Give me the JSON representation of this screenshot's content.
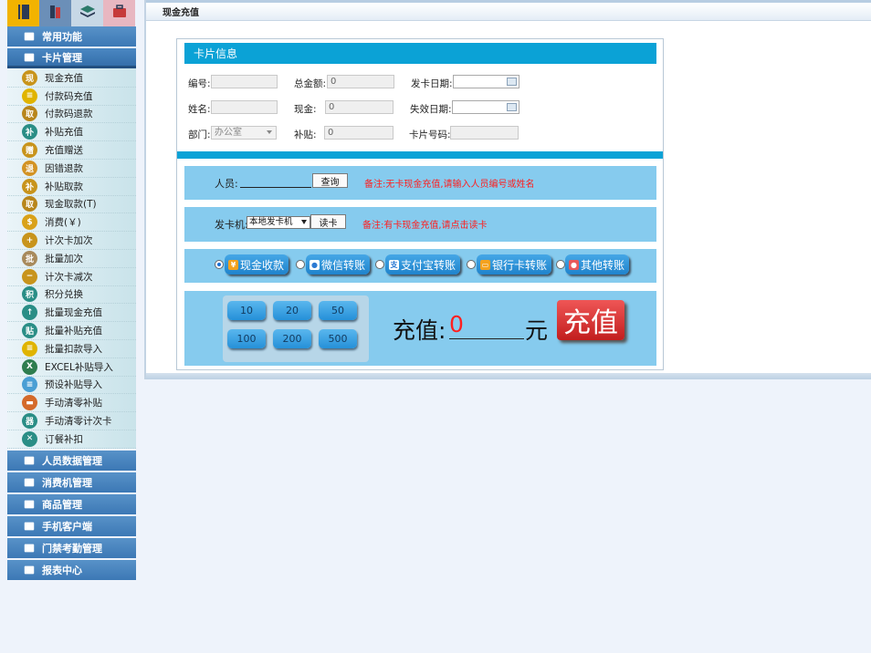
{
  "sidebar": {
    "top_tabs": [
      {
        "icon": "notebook-icon",
        "color": "#f2b300"
      },
      {
        "icon": "books-icon",
        "color": "#6b8fb8"
      },
      {
        "icon": "stack-icon",
        "color": "#c7d8e6"
      },
      {
        "icon": "briefcase-icon",
        "color": "#e8b7c1"
      }
    ],
    "sections_top": [
      {
        "label": "常用功能",
        "icon": "layers-icon"
      },
      {
        "label": "卡片管理",
        "icon": "card-icon"
      }
    ],
    "sub_items": [
      {
        "label": "现金充值",
        "glyph": "现",
        "color": "#c8941c"
      },
      {
        "label": "付款码充值",
        "glyph": "≡",
        "color": "#e0b400"
      },
      {
        "label": "付款码退款",
        "glyph": "取",
        "color": "#b8861c"
      },
      {
        "label": "补贴充值",
        "glyph": "补",
        "color": "#2a8e86"
      },
      {
        "label": "充值赠送",
        "glyph": "赠",
        "color": "#c8941c"
      },
      {
        "label": "因错退款",
        "glyph": "退",
        "color": "#d39324"
      },
      {
        "label": "补贴取款",
        "glyph": "补",
        "color": "#c8941c"
      },
      {
        "label": "现金取款(T)",
        "glyph": "取",
        "color": "#b8861c"
      },
      {
        "label": "消费(￥)",
        "glyph": "$",
        "color": "#d9a21a"
      },
      {
        "label": "计次卡加次",
        "glyph": "+",
        "color": "#c8941c"
      },
      {
        "label": "批量加次",
        "glyph": "批",
        "color": "#a88a5c"
      },
      {
        "label": "计次卡减次",
        "glyph": "−",
        "color": "#c8941c"
      },
      {
        "label": "积分兑换",
        "glyph": "积",
        "color": "#2a8e86"
      },
      {
        "label": "批量现金充值",
        "glyph": "↑",
        "color": "#2a8e86"
      },
      {
        "label": "批量补贴充值",
        "glyph": "贴",
        "color": "#2a8e86"
      },
      {
        "label": "批量扣款导入",
        "glyph": "≡",
        "color": "#e0b400"
      },
      {
        "label": "EXCEL补贴导入",
        "glyph": "X",
        "color": "#2e7d4f"
      },
      {
        "label": "预设补贴导入",
        "glyph": "≡",
        "color": "#4a9fd4"
      },
      {
        "label": "手动清零补贴",
        "glyph": "▬",
        "color": "#d46a2a"
      },
      {
        "label": "手动清零计次卡",
        "glyph": "器",
        "color": "#2a8e86"
      },
      {
        "label": "订餐补扣",
        "glyph": "✕",
        "color": "#2a8e86"
      }
    ],
    "sections_bottom": [
      {
        "label": "人员数据管理",
        "icon": "user-gear-icon"
      },
      {
        "label": "消费机管理",
        "icon": "pos-terminal-icon"
      },
      {
        "label": "商品管理",
        "icon": "goods-icon"
      },
      {
        "label": "手机客户端",
        "icon": "phone-icon"
      },
      {
        "label": "门禁考勤管理",
        "icon": "door-icon"
      },
      {
        "label": "报表中心",
        "icon": "chart-icon"
      }
    ]
  },
  "header": {
    "title": "现金充值"
  },
  "card_info": {
    "title": "卡片信息",
    "number_label": "编号:",
    "total_label": "总金额:",
    "total_value": "0",
    "issue_date_label": "发卡日期:",
    "name_label": "姓名:",
    "cash_label": "现金:",
    "cash_value": "0",
    "expire_label": "失效日期:",
    "dept_label": "部门:",
    "dept_value": "办公室",
    "subsidy_label": "补贴:",
    "subsidy_value": "0",
    "cardno_label": "卡片号码:"
  },
  "search": {
    "person_label": "人员:",
    "query_button": "查询",
    "note": "备注:无卡现金充值,请输入人员编号或姓名"
  },
  "reader": {
    "label": "发卡机:",
    "selected": "本地发卡机",
    "read_button": "读卡",
    "note": "备注:有卡现金充值,请点击读卡"
  },
  "payment_methods": [
    {
      "label": "现金收款",
      "selected": true,
      "glyph": "¥",
      "icon": "yen-icon",
      "color": "#f4a21e"
    },
    {
      "label": "微信转账",
      "selected": false,
      "glyph": "●",
      "icon": "wechat-icon",
      "color": "#ffffff"
    },
    {
      "label": "支付宝转账",
      "selected": false,
      "glyph": "支",
      "icon": "alipay-icon",
      "color": "#ffffff"
    },
    {
      "label": "银行卡转账",
      "selected": false,
      "glyph": "▭",
      "icon": "bankcard-icon",
      "color": "#f4a21e"
    },
    {
      "label": "其他转账",
      "selected": false,
      "glyph": "●",
      "icon": "other-pay-icon",
      "color": "#e85a5a"
    }
  ],
  "amounts": [
    "10",
    "20",
    "50",
    "100",
    "200",
    "500"
  ],
  "recharge": {
    "label": "充值:",
    "value": "0",
    "unit": "元",
    "button": "充值"
  },
  "colors": {
    "accent": "#0ba2d6",
    "panel_bg": "#86cbee",
    "note": "#ff1e1e",
    "charge_button": "#d63a3a"
  }
}
